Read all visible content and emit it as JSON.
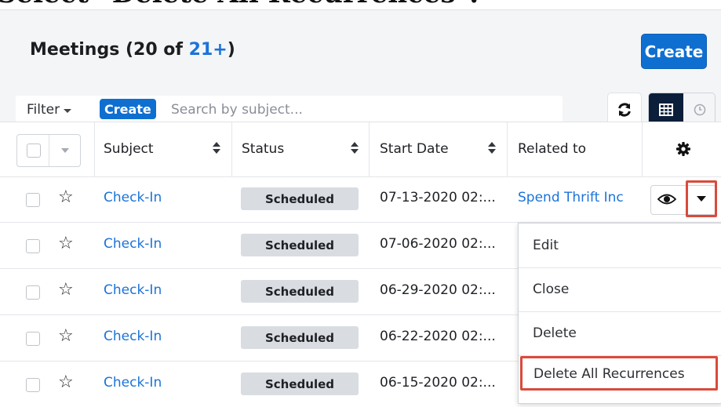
{
  "caption": "Select \"Delete All Recurrences\".",
  "header": {
    "title_prefix": "Meetings (20 of ",
    "title_count": "21+",
    "title_suffix": ")",
    "create_label": "Create"
  },
  "filterbar": {
    "filter_label": "Filter",
    "create_label": "Create",
    "search_placeholder": "Search by subject..."
  },
  "table": {
    "columns": [
      "Subject",
      "Status",
      "Start Date",
      "Related to"
    ],
    "rows": [
      {
        "subject": "Check-In",
        "status": "Scheduled",
        "start_date": "07-13-2020 02:...",
        "related": "Spend Thrift Inc"
      },
      {
        "subject": "Check-In",
        "status": "Scheduled",
        "start_date": "07-06-2020 02:...",
        "related": ""
      },
      {
        "subject": "Check-In",
        "status": "Scheduled",
        "start_date": "06-29-2020 02:...",
        "related": ""
      },
      {
        "subject": "Check-In",
        "status": "Scheduled",
        "start_date": "06-22-2020 02:...",
        "related": ""
      },
      {
        "subject": "Check-In",
        "status": "Scheduled",
        "start_date": "06-15-2020 02:...",
        "related": ""
      }
    ]
  },
  "menu": {
    "items": [
      "Edit",
      "Close",
      "Delete",
      "Delete All Recurrences"
    ]
  },
  "icons": {
    "refresh": "refresh-icon",
    "list_view": "list-view-icon",
    "timeline_view": "clock-icon",
    "settings": "gear-icon",
    "favorite": "star-icon",
    "preview": "eye-icon"
  },
  "colors": {
    "accent": "#0f6fd1",
    "link": "#1b73d9",
    "highlight": "#d94b3b",
    "badge": "#d9dde2"
  }
}
